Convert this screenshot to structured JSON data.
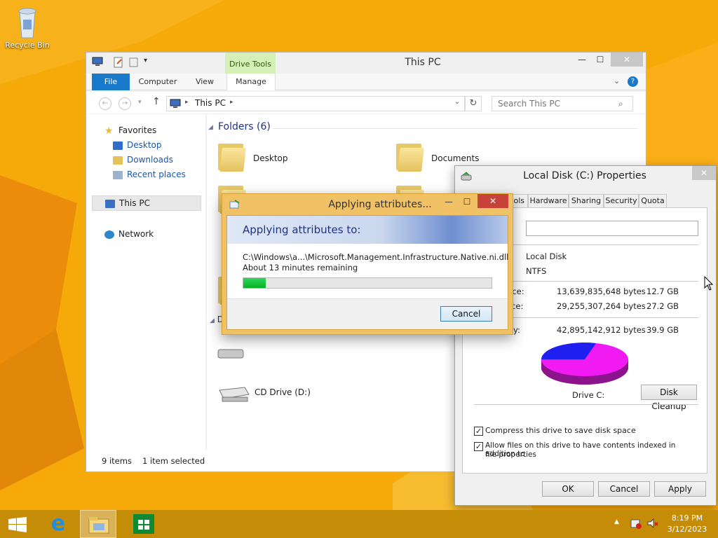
{
  "desktop": {
    "recycle_bin_label": "Recycle Bin"
  },
  "explorer": {
    "title": "This PC",
    "context_tab_group": "Drive Tools",
    "tabs": [
      "File",
      "Computer",
      "View",
      "Manage"
    ],
    "address": "This PC",
    "search_placeholder": "Search This PC",
    "nav": {
      "favorites": "Favorites",
      "desktop": "Desktop",
      "downloads": "Downloads",
      "recent": "Recent places",
      "this_pc": "This PC",
      "network": "Network"
    },
    "folders_header": "Folders (6)",
    "folders": [
      "Desktop",
      "Documents"
    ],
    "devices_header_partial": "D",
    "cd_drive_label": "CD Drive (D:)",
    "status_items": "9 items",
    "status_selected": "1 item selected"
  },
  "properties": {
    "title": "Local Disk (C:) Properties",
    "tabs": [
      "ools",
      "Hardware",
      "Sharing",
      "Security",
      "Quota"
    ],
    "type_value": "Local Disk",
    "filesystem_value": "NTFS",
    "used_label": "pace:",
    "used_bytes": "13,639,835,648 bytes",
    "used_gb": "12.7 GB",
    "free_label": "ace:",
    "free_bytes": "29,255,307,264 bytes",
    "free_gb": "27.2 GB",
    "capacity_label": "y:",
    "capacity_bytes": "42,895,142,912 bytes",
    "capacity_gb": "39.9 GB",
    "drive_label": "Drive C:",
    "disk_cleanup": "Disk Cleanup",
    "compress_label": "Compress this drive to save disk space",
    "index_label_1": "Allow files on this drive to have contents indexed in addition to",
    "index_label_2": "file properties",
    "ok": "OK",
    "cancel": "Cancel",
    "apply": "Apply",
    "used_color": "#1f1ff0",
    "free_color": "#f21af2"
  },
  "progress": {
    "title": "Applying attributes...",
    "heading": "Applying attributes to:",
    "path": "C:\\Windows\\a...\\Microsoft.Management.Infrastructure.Native.ni.dll",
    "remaining": "About 13 minutes remaining",
    "percent": 9,
    "cancel": "Cancel"
  },
  "taskbar": {
    "time": "8:19 PM",
    "date": "3/12/2023"
  }
}
